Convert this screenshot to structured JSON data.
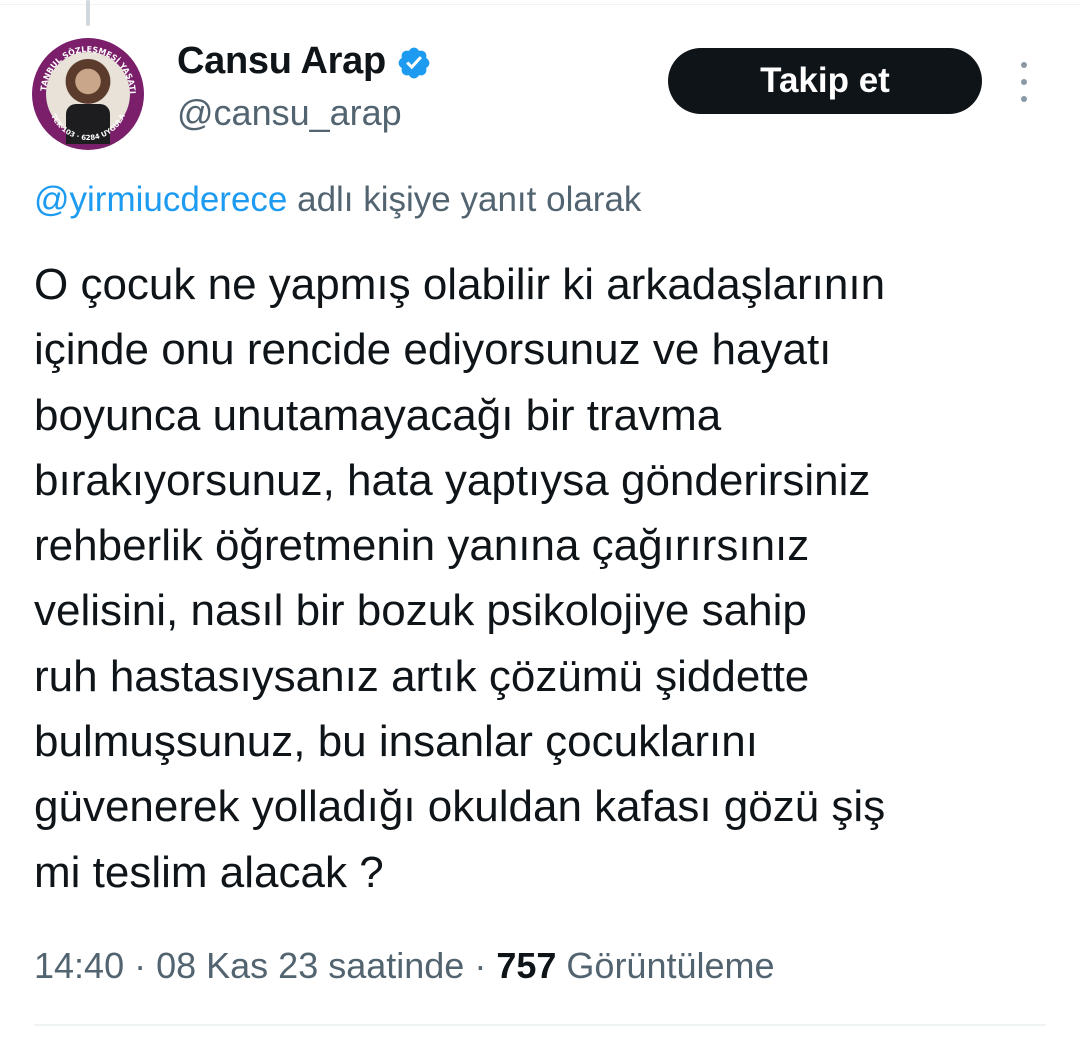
{
  "author": {
    "display_name": "Cansu Arap",
    "handle": "@cansu_arap",
    "verified": true,
    "avatar_ring_text_top": "İSTANBUL SÖZLEŞMESİ YAŞATIR",
    "avatar_ring_text_bottom": "TCK-103 · 6284 UYGULA"
  },
  "actions": {
    "follow_label": "Takip et",
    "more_icon": "more-vertical-icon"
  },
  "reply": {
    "mention": "@yirmiucderece",
    "suffix": " adlı kişiye yanıt olarak"
  },
  "tweet": {
    "lines": [
      "O çocuk ne yapmış olabilir ki arkadaşlarının",
      "içinde onu rencide ediyorsunuz ve hayatı",
      "boyunca unutamayacağı bir travma",
      "bırakıyorsunuz, hata yaptıysa gönderirsiniz",
      "rehberlik öğretmenin yanına çağırırsınız",
      "velisini, nasıl bir bozuk psikolojiye sahip",
      "ruh hastasıysanız artık çözümü şiddette",
      "bulmuşsunuz, bu insanlar çocuklarını",
      "güvenerek yolladığı okuldan kafası gözü şiş",
      "mi teslim alacak ?"
    ]
  },
  "meta": {
    "time": "14:40",
    "separator": " · ",
    "date": "08 Kas 23 saatinde",
    "views_count": "757",
    "views_label": "Görüntüleme"
  },
  "colors": {
    "text": "#0f1419",
    "secondary": "#536471",
    "link": "#1d9bf0",
    "verified": "#1d9bf0",
    "button_bg": "#0f1419",
    "avatar_ring": "#7b1f6b"
  }
}
